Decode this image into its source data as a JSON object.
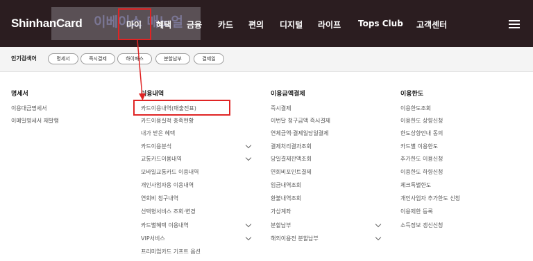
{
  "brand": {
    "logo": "ShinhanCard",
    "ghost_text": "이베이스 매노얼"
  },
  "nav": {
    "items": [
      "마이",
      "혜택",
      "금융",
      "카드",
      "편의",
      "디지털",
      "라이프",
      "Tops Club",
      "고객센터"
    ],
    "menu_icon": "hamburger-menu-icon"
  },
  "keywords": {
    "label": "인기검색어",
    "chips": [
      "명세서",
      "즉시결제",
      "하이패스",
      "분할납부",
      "결제일"
    ]
  },
  "columns": [
    {
      "title": "명세서",
      "items": [
        "이용대금명세서",
        "이메일명세서 재발행"
      ]
    },
    {
      "title": "이용내역",
      "items": [
        "카드이용내역(매출전표)",
        "카드이용실적 충족현황",
        "내가 받은 혜택",
        "카드이용분석",
        "교통카드이용내역",
        "모바일교통카드 이용내역",
        "개인사업자용 이용내역",
        "연회비 청구내역",
        "선택형서비스 조회·변경",
        "카드별혜택 이용내역",
        "VIP서비스",
        "프리미엄카드 기프트 옵션"
      ]
    },
    {
      "title": "이용금액결제",
      "items": [
        "즉시결제",
        "이번달 청구금액 즉시결제",
        "연체금액·결제일당일결제",
        "결제처리결과조회",
        "당일결제잔액조회",
        "연회비포인트결제",
        "입금내역조회",
        "환불내역조회",
        "가상계좌",
        "분할납부",
        "해외이용전 분할납부"
      ]
    },
    {
      "title": "이용한도",
      "items": [
        "이용한도조회",
        "이용한도 상향신청",
        "한도상향안내 동의",
        "카드별 이용한도",
        "추가한도 이용신청",
        "이용한도 하향신청",
        "체크특별한도",
        "개인사업자 추가한도 신청",
        "이용제한 등록",
        "소득정보 갱신신청"
      ]
    }
  ],
  "colors": {
    "nav_bg": "#2b1d20",
    "highlight": "#e02424"
  }
}
